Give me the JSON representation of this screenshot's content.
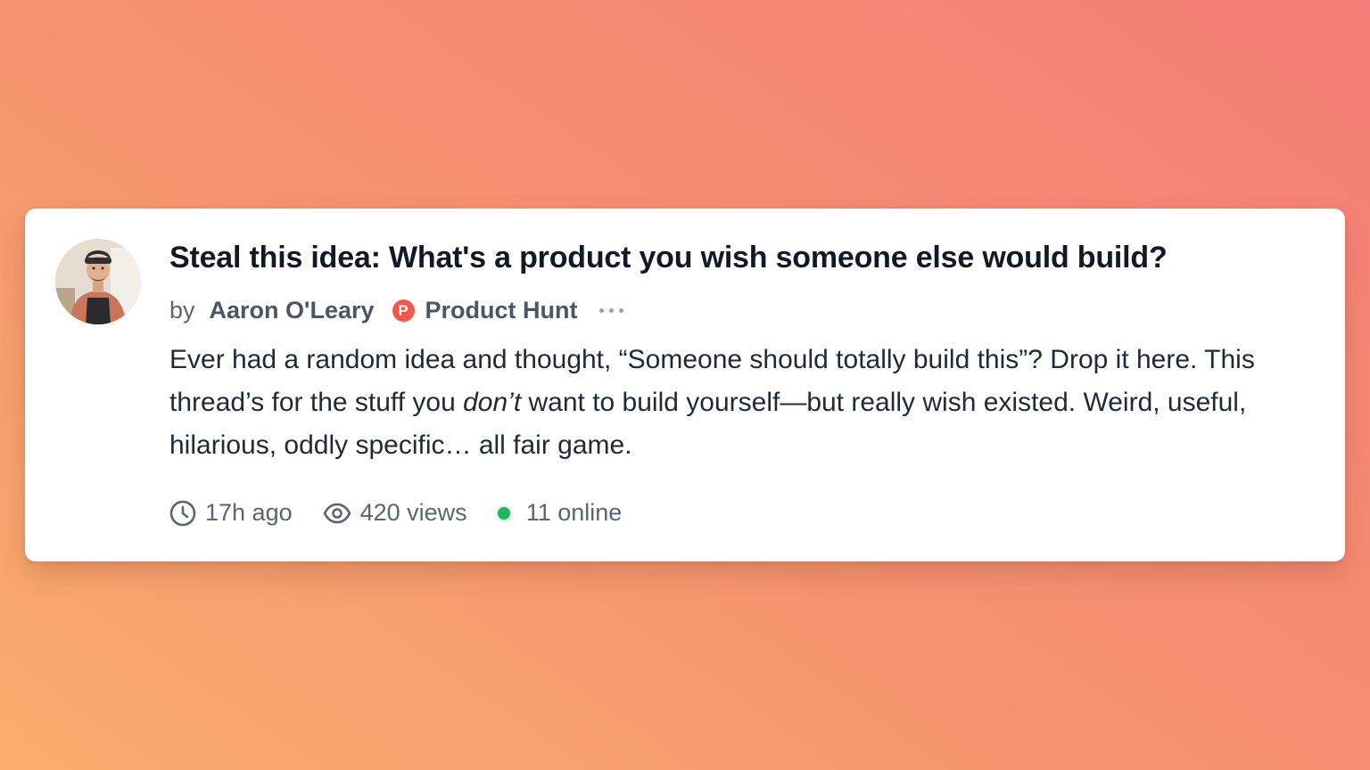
{
  "post": {
    "title": "Steal this idea: What's a product you wish someone else would build?",
    "byline": {
      "by_label": "by",
      "author": "Aaron O'Leary",
      "community_badge_letter": "P",
      "community": "Product Hunt",
      "more_icon": "ellipsis-icon"
    },
    "body": {
      "part1": "Ever had a random idea and thought, “Someone should totally build this”? Drop it here. This thread’s for the stuff you ",
      "emphasis": "don’t",
      "part2": " want to build yourself—but really wish existed. Weird, useful, hilarious, oddly specific… all fair game."
    },
    "meta": {
      "time_icon": "clock-icon",
      "time": "17h ago",
      "views_icon": "eye-icon",
      "views": "420 views",
      "online_icon": "online-status-dot",
      "online": "11 online"
    }
  },
  "colors": {
    "background_gradient": [
      "#f9ad6c",
      "#f67e78"
    ],
    "card": "#ffffff",
    "title": "#121826",
    "muted_text": "#5b6474",
    "product_hunt_brand": "#f5584b",
    "online_green": "#1fb75c"
  }
}
